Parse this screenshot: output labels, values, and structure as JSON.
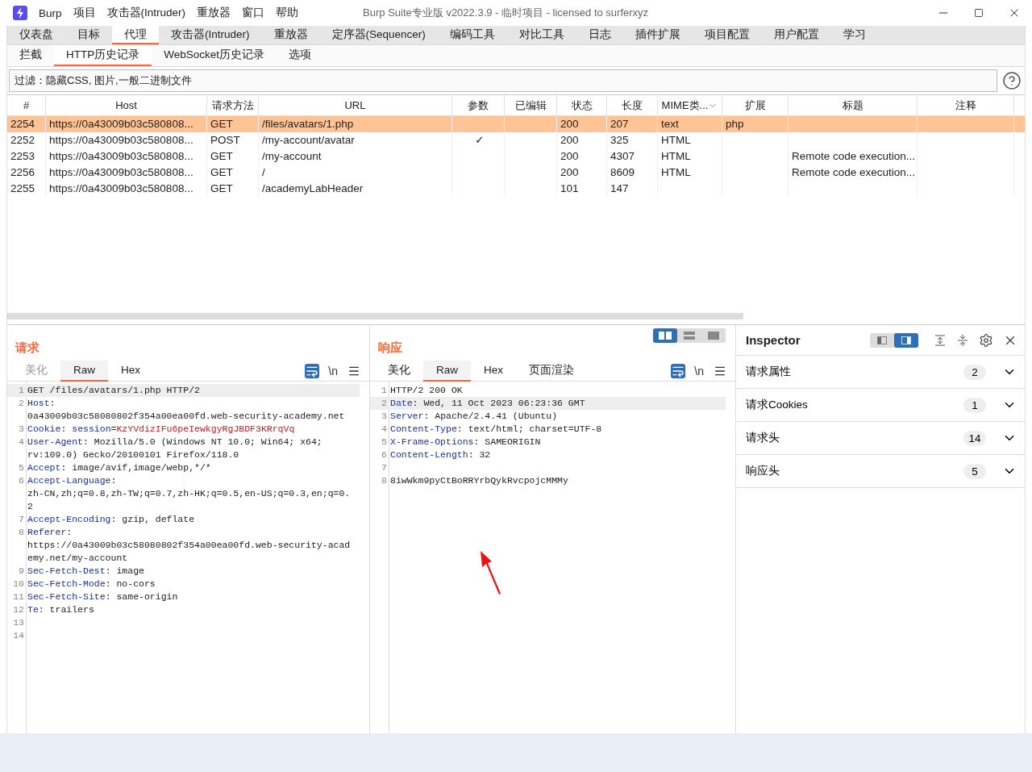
{
  "window": {
    "title": "Burp Suite专业版  v2022.3.9 - 临时项目 - licensed to surferxyz"
  },
  "menu": [
    "Burp",
    "项目",
    "攻击器(Intruder)",
    "重放器",
    "窗口",
    "帮助"
  ],
  "main_tabs": [
    {
      "label": "仪表盘",
      "selected": false
    },
    {
      "label": "目标",
      "selected": false
    },
    {
      "label": "代理",
      "selected": true
    },
    {
      "label": "攻击器(Intruder)",
      "selected": false
    },
    {
      "label": "重放器",
      "selected": false
    },
    {
      "label": "定序器(Sequencer)",
      "selected": false
    },
    {
      "label": "编码工具",
      "selected": false
    },
    {
      "label": "对比工具",
      "selected": false
    },
    {
      "label": "日志",
      "selected": false
    },
    {
      "label": "插件扩展",
      "selected": false
    },
    {
      "label": "项目配置",
      "selected": false
    },
    {
      "label": "用户配置",
      "selected": false
    },
    {
      "label": "学习",
      "selected": false
    }
  ],
  "sub_tabs": [
    {
      "label": "拦截",
      "selected": false
    },
    {
      "label": "HTTP历史记录",
      "selected": true
    },
    {
      "label": "WebSocket历史记录",
      "selected": false
    },
    {
      "label": "选项",
      "selected": false
    }
  ],
  "filter": "过滤：隐藏CSS, 图片,一般二进制文件",
  "table": {
    "columns": [
      "#",
      "Host",
      "请求方法",
      "URL",
      "参数",
      "已编辑",
      "状态",
      "长度",
      "MIME类...",
      "扩展",
      "标题",
      "注释"
    ],
    "rows": [
      {
        "selected": true,
        "cells": [
          "2254",
          "https://0a43009b03c580808...",
          "GET",
          "/files/avatars/1.php",
          "",
          "",
          "200",
          "207",
          "text",
          "php",
          "",
          ""
        ]
      },
      {
        "selected": false,
        "cells": [
          "2252",
          "https://0a43009b03c580808...",
          "POST",
          "/my-account/avatar",
          "✓",
          "",
          "200",
          "325",
          "HTML",
          "",
          "",
          ""
        ]
      },
      {
        "selected": false,
        "cells": [
          "2253",
          "https://0a43009b03c580808...",
          "GET",
          "/my-account",
          "",
          "",
          "200",
          "4307",
          "HTML",
          "",
          "Remote code execution...",
          ""
        ]
      },
      {
        "selected": false,
        "cells": [
          "2256",
          "https://0a43009b03c580808...",
          "GET",
          "/",
          "",
          "",
          "200",
          "8609",
          "HTML",
          "",
          "Remote code execution...",
          ""
        ]
      },
      {
        "selected": false,
        "cells": [
          "2255",
          "https://0a43009b03c580808...",
          "GET",
          "/academyLabHeader",
          "",
          "",
          "101",
          "147",
          "",
          "",
          "",
          ""
        ]
      }
    ]
  },
  "request": {
    "title": "请求",
    "tabs": [
      {
        "label": "美化",
        "selected": false,
        "disabled": true
      },
      {
        "label": "Raw",
        "selected": true,
        "disabled": false
      },
      {
        "label": "Hex",
        "selected": false,
        "disabled": false
      }
    ],
    "newline_label": "\\n",
    "lines": [
      {
        "number": "1",
        "highlighted": true,
        "rows": [
          [
            {
              "kind": "plain",
              "text": "GET /files/avatars/1.php HTTP/2"
            }
          ]
        ]
      },
      {
        "number": "2",
        "highlighted": false,
        "rows": [
          [
            {
              "kind": "key",
              "text": "Host"
            },
            {
              "kind": "plain",
              "text": ":"
            }
          ],
          [
            {
              "kind": "plain",
              "text": "0a43009b03c58080802f354a00ea00fd.web-security-academy.net"
            }
          ]
        ]
      },
      {
        "number": "3",
        "highlighted": false,
        "rows": [
          [
            {
              "kind": "key",
              "text": "Cookie"
            },
            {
              "kind": "plain",
              "text": ": "
            },
            {
              "kind": "key",
              "text": "session"
            },
            {
              "kind": "plain",
              "text": "="
            },
            {
              "kind": "secret",
              "text": "KzYVdizIFu6peIewkgyRgJBDF3KRrqVq"
            }
          ]
        ]
      },
      {
        "number": "4",
        "highlighted": false,
        "rows": [
          [
            {
              "kind": "key",
              "text": "User-Agent"
            },
            {
              "kind": "plain",
              "text": ": Mozilla/5.0 (Windows NT 10.0; Win64; x64;"
            }
          ],
          [
            {
              "kind": "plain",
              "text": "rv:109.0) Gecko/20100101 Firefox/118.0"
            }
          ]
        ]
      },
      {
        "number": "5",
        "highlighted": false,
        "rows": [
          [
            {
              "kind": "key",
              "text": "Accept"
            },
            {
              "kind": "plain",
              "text": ": image/avif,image/webp,*/*"
            }
          ]
        ]
      },
      {
        "number": "6",
        "highlighted": false,
        "rows": [
          [
            {
              "kind": "key",
              "text": "Accept-Language"
            },
            {
              "kind": "plain",
              "text": ":"
            }
          ],
          [
            {
              "kind": "plain",
              "text": "zh-CN,zh;q=0.8,zh-TW;q=0.7,zh-HK;q=0.5,en-US;q=0.3,en;q=0."
            }
          ],
          [
            {
              "kind": "plain",
              "text": "2"
            }
          ]
        ]
      },
      {
        "number": "7",
        "highlighted": false,
        "rows": [
          [
            {
              "kind": "key",
              "text": "Accept-Encoding"
            },
            {
              "kind": "plain",
              "text": ": gzip, deflate"
            }
          ]
        ]
      },
      {
        "number": "8",
        "highlighted": false,
        "rows": [
          [
            {
              "kind": "key",
              "text": "Referer"
            },
            {
              "kind": "plain",
              "text": ":"
            }
          ],
          [
            {
              "kind": "plain",
              "text": "https://0a43009b03c58080802f354a00ea00fd.web-security-acad"
            }
          ],
          [
            {
              "kind": "plain",
              "text": "emy.net/my-account"
            }
          ]
        ]
      },
      {
        "number": "9",
        "highlighted": false,
        "rows": [
          [
            {
              "kind": "key",
              "text": "Sec-Fetch-Dest"
            },
            {
              "kind": "plain",
              "text": ": image"
            }
          ]
        ]
      },
      {
        "number": "10",
        "highlighted": false,
        "rows": [
          [
            {
              "kind": "key",
              "text": "Sec-Fetch-Mode"
            },
            {
              "kind": "plain",
              "text": ": no-cors"
            }
          ]
        ]
      },
      {
        "number": "11",
        "highlighted": false,
        "rows": [
          [
            {
              "kind": "key",
              "text": "Sec-Fetch-Site"
            },
            {
              "kind": "plain",
              "text": ": same-origin"
            }
          ]
        ]
      },
      {
        "number": "12",
        "highlighted": false,
        "rows": [
          [
            {
              "kind": "key",
              "text": "Te"
            },
            {
              "kind": "plain",
              "text": ": trailers"
            }
          ]
        ]
      },
      {
        "number": "13",
        "highlighted": false,
        "rows": [
          []
        ]
      },
      {
        "number": "14",
        "highlighted": false,
        "rows": [
          []
        ]
      }
    ]
  },
  "response": {
    "title": "响应",
    "layout_buttons": [
      {
        "selected": true
      },
      {
        "selected": false
      },
      {
        "selected": false
      }
    ],
    "tabs": [
      {
        "label": "美化",
        "selected": false,
        "disabled": false
      },
      {
        "label": "Raw",
        "selected": true,
        "disabled": false
      },
      {
        "label": "Hex",
        "selected": false,
        "disabled": false
      },
      {
        "label": "页面渲染",
        "selected": false,
        "disabled": false
      }
    ],
    "newline_label": "\\n",
    "lines": [
      {
        "number": "1",
        "highlighted": false,
        "rows": [
          [
            {
              "kind": "plain",
              "text": "HTTP/2 200 OK"
            }
          ]
        ]
      },
      {
        "number": "2",
        "highlighted": true,
        "rows": [
          [
            {
              "kind": "key",
              "text": "Date"
            },
            {
              "kind": "plain",
              "text": ": Wed, 11 Oct 2023 06:23:36 GMT"
            }
          ]
        ]
      },
      {
        "number": "3",
        "highlighted": false,
        "rows": [
          [
            {
              "kind": "key",
              "text": "Server"
            },
            {
              "kind": "plain",
              "text": ": Apache/2.4.41 (Ubuntu)"
            }
          ]
        ]
      },
      {
        "number": "4",
        "highlighted": false,
        "rows": [
          [
            {
              "kind": "key",
              "text": "Content-Type"
            },
            {
              "kind": "plain",
              "text": ": text/html; charset=UTF-8"
            }
          ]
        ]
      },
      {
        "number": "5",
        "highlighted": false,
        "rows": [
          [
            {
              "kind": "key",
              "text": "X-Frame-Options"
            },
            {
              "kind": "plain",
              "text": ": SAMEORIGIN"
            }
          ]
        ]
      },
      {
        "number": "6",
        "highlighted": false,
        "rows": [
          [
            {
              "kind": "key",
              "text": "Content-Length"
            },
            {
              "kind": "plain",
              "text": ": 32"
            }
          ]
        ]
      },
      {
        "number": "7",
        "highlighted": false,
        "rows": [
          []
        ]
      },
      {
        "number": "8",
        "highlighted": false,
        "rows": [
          [
            {
              "kind": "plain",
              "text": "8iwWkm9pyCtBoRRYrbQykRvcpojcMMMy"
            }
          ]
        ]
      }
    ]
  },
  "inspector": {
    "title": "Inspector",
    "layout_buttons": [
      {
        "selected": false
      },
      {
        "selected": true
      }
    ],
    "sections": [
      {
        "label": "请求属性",
        "count": "2"
      },
      {
        "label": "请求Cookies",
        "count": "1"
      },
      {
        "label": "请求头",
        "count": "14"
      },
      {
        "label": "响应头",
        "count": "5"
      }
    ]
  }
}
